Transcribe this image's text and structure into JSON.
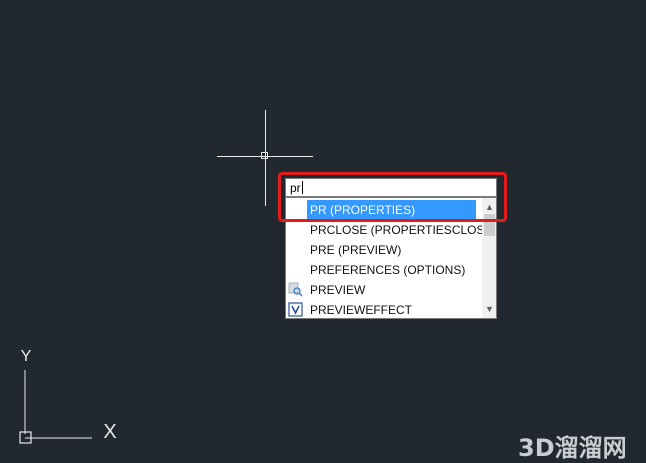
{
  "command": {
    "input_value": "pr"
  },
  "autocomplete": {
    "items": [
      {
        "label": "PR (PROPERTIES)",
        "icon": "",
        "selected": true
      },
      {
        "label": "PRCLOSE (PROPERTIESCLOSE)",
        "icon": "",
        "selected": false
      },
      {
        "label": "PRE (PREVIEW)",
        "icon": "",
        "selected": false
      },
      {
        "label": "PREFERENCES (OPTIONS)",
        "icon": "",
        "selected": false
      },
      {
        "label": "PREVIEW",
        "icon": "preview-magnifier-icon",
        "selected": false
      },
      {
        "label": "PREVIEWEFFECT",
        "icon": "preview-effect-v-icon",
        "selected": false
      }
    ],
    "selected_color": "#3399ff"
  },
  "ucs": {
    "y_label": "Y",
    "x_label": "X"
  },
  "watermark": {
    "text": "3D溜溜网"
  },
  "colors": {
    "background": "#212830",
    "highlight": "#e21c1c"
  }
}
